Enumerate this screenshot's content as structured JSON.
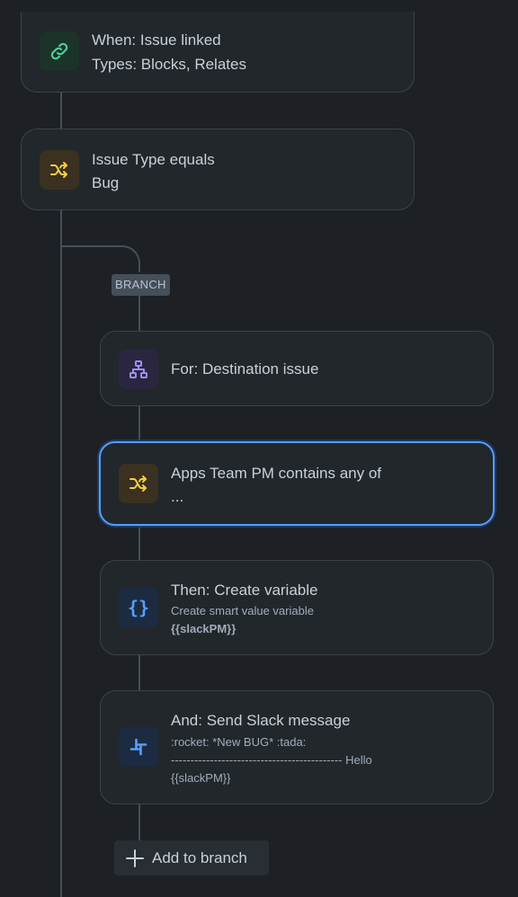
{
  "flow": {
    "trigger": {
      "title": "When: Issue linked",
      "detail": "Types: Blocks, Relates",
      "icon": "link-icon"
    },
    "condition": {
      "title": "Issue Type equals",
      "detail": "Bug",
      "icon": "shuffle-icon"
    },
    "branch_badge": "BRANCH",
    "branch": {
      "for_each": {
        "title": "For: Destination issue",
        "icon": "hierarchy-icon"
      },
      "condition": {
        "title": "Apps Team PM contains any of",
        "detail": "...",
        "icon": "shuffle-icon",
        "selected": true
      },
      "create_variable": {
        "title": "Then: Create variable",
        "desc": "Create smart value variable",
        "value": "{{slackPM}}",
        "icon": "curly-braces-icon"
      },
      "send_slack": {
        "title": "And: Send Slack message",
        "line1": ":rocket: *New BUG* :tada:",
        "line2": "-------------------------------------------- Hello",
        "line3": "{{slackPM}}",
        "icon": "slack-icon"
      },
      "add_label": "Add to branch"
    }
  },
  "colors": {
    "background": "#1d2125",
    "card": "#22272b",
    "selected_border": "#579dff",
    "green_icon": "#4bce97",
    "yellow_icon": "#f5cd47",
    "purple_icon": "#9f8fef",
    "blue_icon": "#579dff"
  }
}
